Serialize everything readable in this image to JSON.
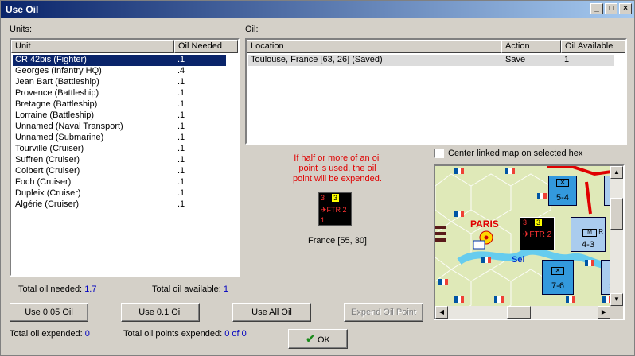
{
  "window": {
    "title": "Use Oil"
  },
  "units": {
    "label": "Units:",
    "columns": [
      "Unit",
      "Oil Needed"
    ],
    "rows": [
      {
        "unit": "CR 42bis (Fighter)",
        "oil": ".1",
        "selected": true
      },
      {
        "unit": "Georges (Infantry HQ)",
        "oil": ".4"
      },
      {
        "unit": "Jean Bart (Battleship)",
        "oil": ".1"
      },
      {
        "unit": "Provence (Battleship)",
        "oil": ".1"
      },
      {
        "unit": "Bretagne (Battleship)",
        "oil": ".1"
      },
      {
        "unit": "Lorraine (Battleship)",
        "oil": ".1"
      },
      {
        "unit": "Unnamed (Naval Transport)",
        "oil": ".1"
      },
      {
        "unit": "Unnamed (Submarine)",
        "oil": ".1"
      },
      {
        "unit": "Tourville (Cruiser)",
        "oil": ".1"
      },
      {
        "unit": "Suffren (Cruiser)",
        "oil": ".1"
      },
      {
        "unit": "Colbert (Cruiser)",
        "oil": ".1"
      },
      {
        "unit": "Foch (Cruiser)",
        "oil": ".1"
      },
      {
        "unit": "Dupleix (Cruiser)",
        "oil": ".1"
      },
      {
        "unit": "Algérie (Cruiser)",
        "oil": ".1"
      }
    ]
  },
  "oil": {
    "label": "Oil:",
    "columns": [
      "Location",
      "Action",
      "Oil Available"
    ],
    "rows": [
      {
        "location": "Toulouse, France [63, 26] (Saved)",
        "action": "Save",
        "available": "1"
      }
    ]
  },
  "warning": "If half or more of an oil point is used, the oil point will be expended.",
  "counter": {
    "left_num": "3",
    "center_num": "3",
    "label": "FTR 2",
    "bottom_num": "1",
    "location": "France [55, 30]"
  },
  "center_map_checkbox": {
    "label": "Center linked map on selected hex",
    "checked": false
  },
  "map": {
    "city": "PARIS",
    "river": "Sei",
    "units": [
      {
        "label": "5-4"
      },
      {
        "label": "5-"
      },
      {
        "label": "4-3",
        "tag": "R"
      },
      {
        "label": "7-6"
      },
      {
        "label": "3-"
      }
    ],
    "counter_label": "FTR 2"
  },
  "totals": {
    "needed_label": "Total oil needed:",
    "needed_value": "1.7",
    "available_label": "Total oil available:",
    "available_value": "1",
    "expended_label": "Total oil expended:",
    "expended_value": "0",
    "points_label": "Total oil points expended:",
    "points_value": "0 of 0"
  },
  "buttons": {
    "use_005": "Use 0.05 Oil",
    "use_01": "Use 0.1 Oil",
    "use_all": "Use All Oil",
    "expend": "Expend Oil Point",
    "ok": "OK"
  },
  "colors": {
    "title_start": "#0a246a",
    "title_end": "#a6caf0",
    "selection": "#0a246a",
    "value_blue": "#0000c0",
    "warning_red": "#e00000"
  }
}
